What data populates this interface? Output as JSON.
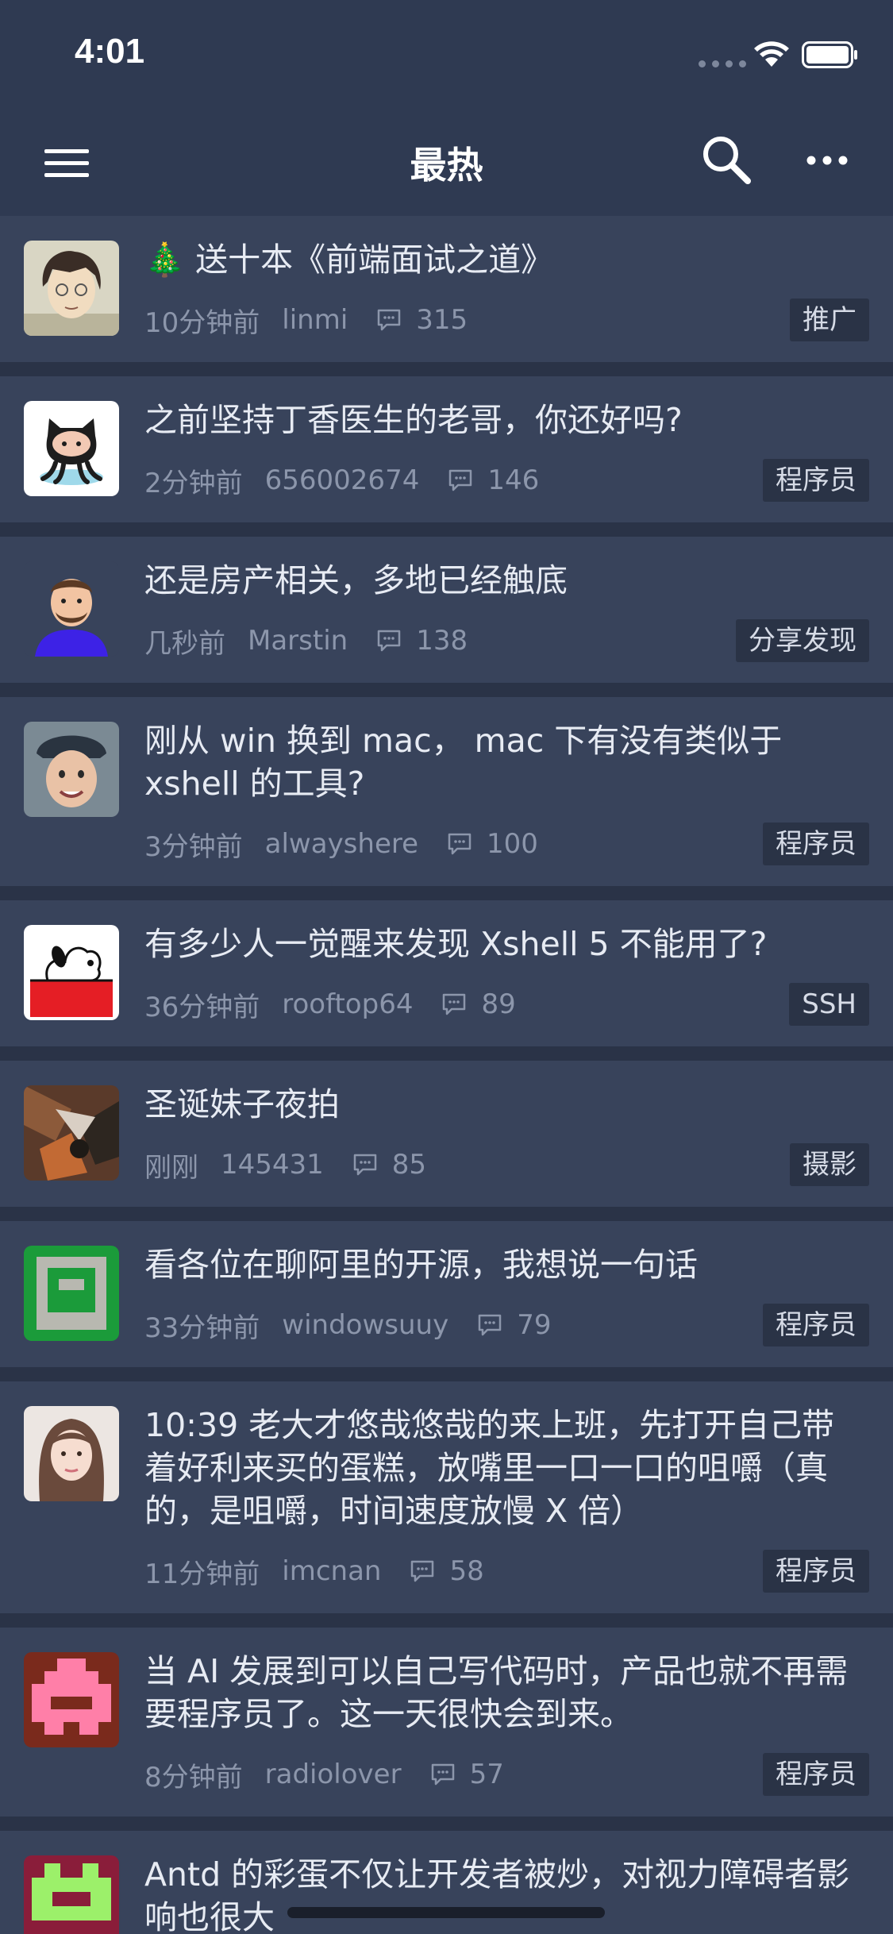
{
  "status_bar": {
    "time": "4:01"
  },
  "nav": {
    "title": "最热"
  },
  "icons": {
    "menu": "hamburger-menu-icon",
    "search": "search-icon",
    "more": "more-dots-icon",
    "comment": "comment-bubble-icon"
  },
  "colors": {
    "background": "#2a3347",
    "card": "#38435b",
    "nav": "#2f3a52",
    "tag_bg": "#2a3346",
    "meta": "#8c96ab"
  },
  "feed": [
    {
      "title": "🎄 送十本《前端面试之道》",
      "time": "10分钟前",
      "author": "linmi",
      "comments": "315",
      "tag": "推广",
      "avatar": "cartoon-boy"
    },
    {
      "title": "之前坚持丁香医生的老哥，你还好吗?",
      "time": "2分钟前",
      "author": "656002674",
      "comments": "146",
      "tag": "程序员",
      "avatar": "octocat"
    },
    {
      "title": "还是房产相关，多地已经触底",
      "time": "几秒前",
      "author": "Marstin",
      "comments": "138",
      "tag": "分享发现",
      "avatar": "bearded-man"
    },
    {
      "title": "刚从 win 换到 mac， mac 下有没有类似于 xshell 的工具?",
      "time": "3分钟前",
      "author": "alwayshere",
      "comments": "100",
      "tag": "程序员",
      "avatar": "kid-photo"
    },
    {
      "title": "有多少人一觉醒来发现 Xshell 5 不能用了?",
      "time": "36分钟前",
      "author": "rooftop64",
      "comments": "89",
      "tag": "SSH",
      "avatar": "snoopy"
    },
    {
      "title": "圣诞妹子夜拍",
      "time": "刚刚",
      "author": "145431",
      "comments": "85",
      "tag": "摄影",
      "avatar": "dark-art"
    },
    {
      "title": "看各位在聊阿里的开源，我想说一句话",
      "time": "33分钟前",
      "author": "windowsuuy",
      "comments": "79",
      "tag": "程序员",
      "avatar": "green-pixel"
    },
    {
      "title": "10:39 老大才悠哉悠哉的来上班，先打开自己带着好利来买的蛋糕，放嘴里一口一口的咀嚼（真的，是咀嚼，时间速度放慢 X 倍）",
      "time": "11分钟前",
      "author": "imcnan",
      "comments": "58",
      "tag": "程序员",
      "avatar": "girl-photo"
    },
    {
      "title": "当 AI 发展到可以自己写代码时，产品也就不再需要程序员了。这一天很快会到来。",
      "time": "8分钟前",
      "author": "radiolover",
      "comments": "57",
      "tag": "程序员",
      "avatar": "pink-pixel"
    },
    {
      "title": "Antd 的彩蛋不仅让开发者被炒，对视力障碍者影响也很大",
      "time": "",
      "author": "",
      "comments": "",
      "tag": "",
      "avatar": "green-pixel-2"
    }
  ]
}
